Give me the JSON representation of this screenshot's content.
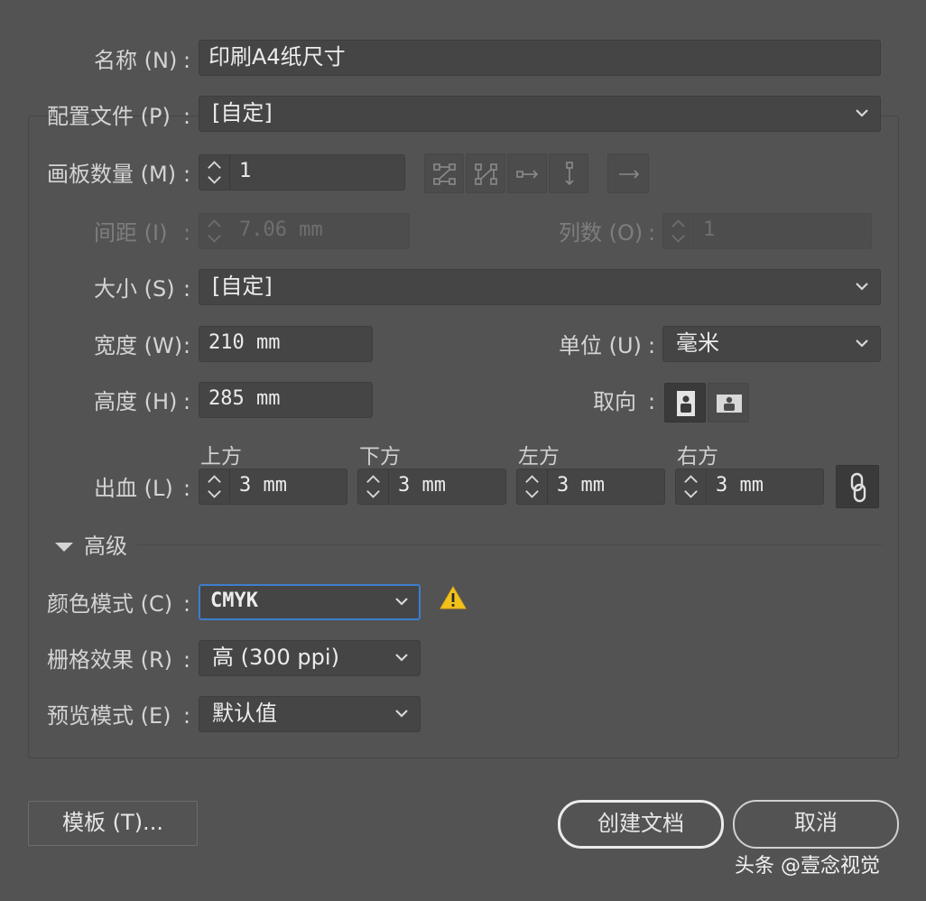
{
  "name": {
    "label": "名称 (N)",
    "value": "印刷A4纸尺寸"
  },
  "profile": {
    "label": "配置文件 (P)",
    "value": "[自定]"
  },
  "artboards": {
    "label": "画板数量 (M)",
    "value": "1",
    "layout_icons": [
      "grid-by-row-icon",
      "grid-by-column-icon",
      "arrange-by-row-icon",
      "arrange-by-column-icon",
      "change-to-rtl-icon"
    ]
  },
  "spacing": {
    "label": "间距 (I)",
    "value": "7.06 mm"
  },
  "columns": {
    "label": "列数 (O)",
    "value": "1"
  },
  "size": {
    "label": "大小 (S)",
    "value": "[自定]"
  },
  "width": {
    "label": "宽度 (W)",
    "value": "210 mm"
  },
  "height": {
    "label": "高度 (H)",
    "value": "285 mm"
  },
  "units": {
    "label": "单位 (U)",
    "value": "毫米"
  },
  "orientation": {
    "label": "取向",
    "selected": "portrait"
  },
  "bleed": {
    "label": "出血 (L)",
    "top": {
      "label": "上方",
      "value": "3 mm"
    },
    "bottom": {
      "label": "下方",
      "value": "3 mm"
    },
    "left": {
      "label": "左方",
      "value": "3 mm"
    },
    "right": {
      "label": "右方",
      "value": "3 mm"
    },
    "linked": true
  },
  "advanced": {
    "label": "高级",
    "expanded": true
  },
  "color_mode": {
    "label": "颜色模式 (C)",
    "value": "CMYK",
    "warning": true
  },
  "raster": {
    "label": "栅格效果 (R)",
    "value": "高 (300 ppi)"
  },
  "preview": {
    "label": "预览模式 (E)",
    "value": "默认值"
  },
  "buttons": {
    "templates": "模板 (T)...",
    "create": "创建文档",
    "cancel": "取消"
  },
  "watermark": "头条 @壹念视觉",
  "colors": {
    "background": "#535353",
    "field": "#454545",
    "focus": "#3d7ecf",
    "warning": "#f2c21a"
  }
}
